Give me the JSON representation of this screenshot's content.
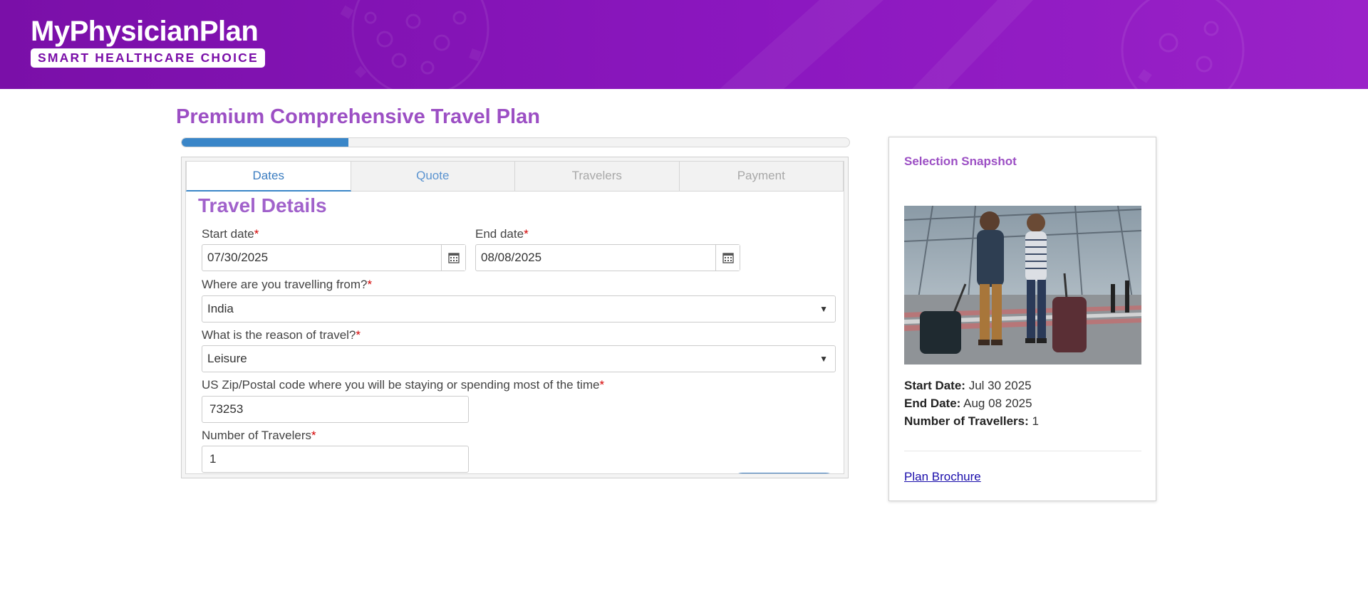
{
  "brand": {
    "name": "MyPhysicianPlan",
    "tagline": "SMART HEALTHCARE CHOICE",
    "header_color": "#8b17bf"
  },
  "page": {
    "title": "Premium Comprehensive Travel Plan",
    "progress_fraction": 0.25
  },
  "tabs": [
    {
      "label": "Dates",
      "state": "active"
    },
    {
      "label": "Quote",
      "state": "next"
    },
    {
      "label": "Travelers",
      "state": "disabled"
    },
    {
      "label": "Payment",
      "state": "disabled"
    }
  ],
  "form": {
    "section_title": "Travel Details",
    "start_date": {
      "label": "Start date",
      "required_mark": "*",
      "value": "07/30/2025",
      "icon": "calendar-icon"
    },
    "end_date": {
      "label": "End date",
      "required_mark": "*",
      "value": "08/08/2025",
      "icon": "calendar-icon"
    },
    "from_country": {
      "label": "Where are you travelling from?",
      "required_mark": "*",
      "value": "India"
    },
    "reason": {
      "label": "What is the reason of travel?",
      "required_mark": "*",
      "value": "Leisure"
    },
    "zip": {
      "label": "US Zip/Postal code where you will be staying or spending most of the time",
      "required_mark": "*",
      "value": "73253"
    },
    "travelers": {
      "label": "Number of Travelers",
      "required_mark": "*",
      "value": "1"
    }
  },
  "snapshot": {
    "title": "Selection Snapshot",
    "start_label": "Start Date:",
    "start_value": "Jul 30 2025",
    "end_label": "End Date:",
    "end_value": "Aug 08 2025",
    "travellers_label": "Number of Travellers:",
    "travellers_value": "1",
    "brochure_link": "Plan Brochure"
  },
  "colors": {
    "accent_purple": "#9c4fc4",
    "primary_blue": "#3a86c8",
    "required_red": "#d40000",
    "link_blue": "#1a0dab"
  }
}
